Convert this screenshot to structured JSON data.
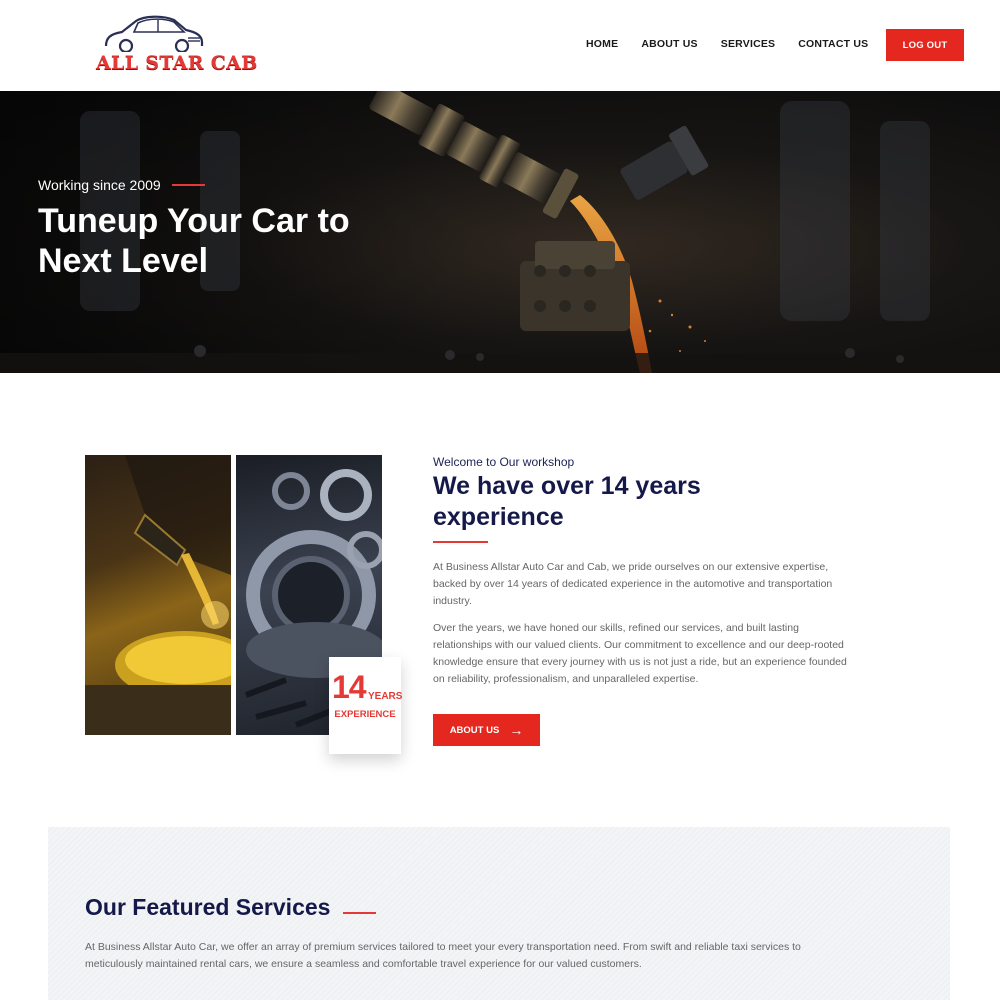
{
  "brand": {
    "name": "ALL STAR CAB",
    "accent": "#e53935",
    "navy": "#15194a"
  },
  "nav": {
    "items": [
      "HOME",
      "ABOUT US",
      "SERVICES",
      "CONTACT US"
    ],
    "logout_label": "LOG OUT"
  },
  "hero": {
    "eyebrow": "Working since 2009",
    "title": "Tuneup Your Car to Next Level"
  },
  "about": {
    "eyebrow": "Welcome to Our workshop",
    "title": "We have over 14 years experience",
    "paragraph_1": "At Business Allstar Auto Car and Cab, we pride ourselves on our extensive expertise, backed by over 14 years of dedicated experience in the automotive and transportation industry.",
    "paragraph_2": "Over the years, we have honed our skills, refined our services, and built lasting relationships with our valued clients. Our commitment to excellence and our deep-rooted knowledge ensure that every journey with us is not just a ride, but an experience founded on reliability, professionalism, and unparalleled expertise.",
    "button_label": "ABOUT US",
    "badge": {
      "number": "14",
      "years": "YEARS",
      "label": "EXPERIENCE"
    }
  },
  "services": {
    "title": "Our Featured Services",
    "description": "At Business Allstar Auto Car, we offer an array of premium services tailored to meet your every transportation need. From swift and reliable taxi services to meticulously maintained rental cars, we ensure a seamless and comfortable travel experience for our valued customers."
  },
  "icons": {
    "logo": "car-outline-icon",
    "button_arrow": "arrow-right-icon"
  }
}
